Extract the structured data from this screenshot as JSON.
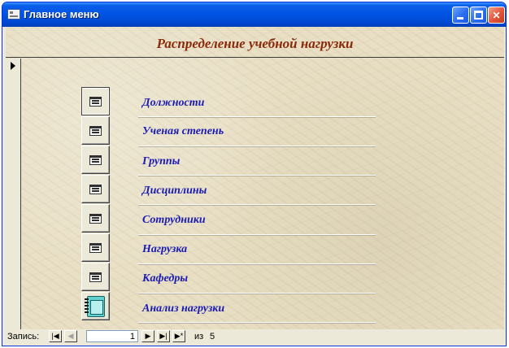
{
  "window": {
    "title": "Главное меню"
  },
  "header": {
    "title": "Распределение учебной нагрузки"
  },
  "menu": {
    "items": [
      {
        "label": "Должности",
        "icon": "form-icon"
      },
      {
        "label": "Ученая степень",
        "icon": "form-icon"
      },
      {
        "label": "Группы",
        "icon": "form-icon"
      },
      {
        "label": "Дисциплины",
        "icon": "form-icon"
      },
      {
        "label": "Сотрудники",
        "icon": "form-icon"
      },
      {
        "label": "Нагрузка",
        "icon": "form-icon"
      },
      {
        "label": "Кафедры",
        "icon": "form-icon"
      },
      {
        "label": "Анализ нагрузки",
        "icon": "report-icon"
      }
    ]
  },
  "navigation": {
    "record_label": "Запись:",
    "first_glyph": "|◀",
    "prev_glyph": "◀",
    "current": "1",
    "next_glyph": "▶",
    "last_glyph": "▶|",
    "new_glyph": "▶*",
    "of_label": "из",
    "total": "5"
  },
  "colors": {
    "title_text": "#8b2a0a",
    "menu_text": "#1a1ab5",
    "form_background": "#e8dfc4",
    "titlebar": "#0054e3"
  }
}
